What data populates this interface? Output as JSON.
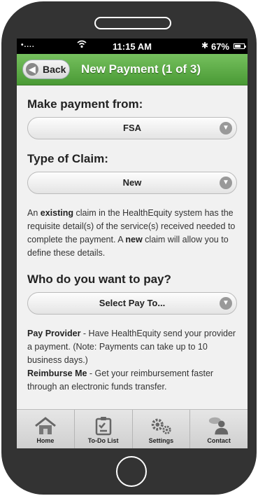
{
  "status_bar": {
    "signal": "•....",
    "time": "11:15 AM",
    "battery": "67%",
    "battery_level": 0.67
  },
  "header": {
    "back_label": "Back",
    "title": "New Payment (1 of 3)"
  },
  "form": {
    "payment_from": {
      "label": "Make payment from:",
      "value": "FSA"
    },
    "claim_type": {
      "label": "Type of Claim:",
      "value": "New"
    },
    "claim_description": {
      "part1": "An ",
      "bold1": "existing",
      "part2": " claim in the HealthEquity system has the requisite detail(s) of the service(s) received needed to complete the payment. A ",
      "bold2": "new",
      "part3": " claim will allow you to define these details."
    },
    "pay_to": {
      "label": "Who do you want to pay?",
      "value": "Select Pay To..."
    },
    "pay_provider": {
      "title": "Pay Provider",
      "text": " - Have HealthEquity send your provider a payment. (Note: Payments can take up to 10 business days.)"
    },
    "reimburse_me": {
      "title": "Reimburse Me",
      "text": " - Get your reimbursement faster through an electronic funds transfer."
    }
  },
  "tabs": [
    {
      "label": "Home",
      "icon": "home-icon"
    },
    {
      "label": "To-Do List",
      "icon": "todo-list-icon"
    },
    {
      "label": "Settings",
      "icon": "gears-icon"
    },
    {
      "label": "Contact",
      "icon": "contact-icon"
    }
  ],
  "colors": {
    "header_green": "#5aac42",
    "phone_body": "#333333"
  }
}
